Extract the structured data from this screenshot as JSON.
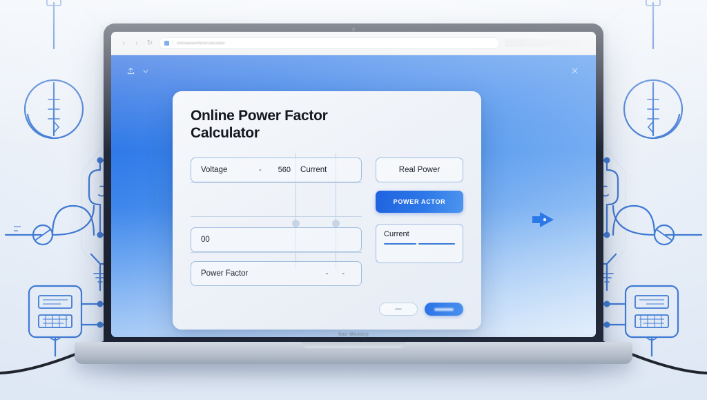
{
  "scene": {
    "device": "laptop",
    "bezel_label": "Sac Mooocy",
    "accent_color": "#2d78e8",
    "page_gradient_from": "#1f64e0",
    "page_gradient_to": "#cfe2f8",
    "schematic_color": "#2f6ed0"
  },
  "browser": {
    "nav_icons": [
      "back-icon",
      "forward-icon",
      "reload-icon"
    ],
    "url_text": "onlinepowerfactorcalculator",
    "favicon": "site-favicon"
  },
  "page_toolbar": {
    "icons": [
      "share-icon",
      "chevron-down-icon"
    ],
    "close_label": "×"
  },
  "marker": {
    "name": "arrow-pointer",
    "color": "#2d78e8"
  },
  "card": {
    "title": "Online Power Factor\nCalculator",
    "fields": [
      {
        "label": "Voltage",
        "dash": "-",
        "value": "560",
        "suffix": "Current"
      },
      {
        "label": "00",
        "dash": "",
        "value": "",
        "suffix": ""
      },
      {
        "label": "Power Factor",
        "dash": "-",
        "value": "",
        "suffix": "-"
      }
    ],
    "side": {
      "real_power_label": "Real Power",
      "power_factor_button": "POWER ACTOR",
      "result_label": "Current"
    },
    "actions": {
      "secondary_label": "",
      "primary_label": ""
    }
  }
}
